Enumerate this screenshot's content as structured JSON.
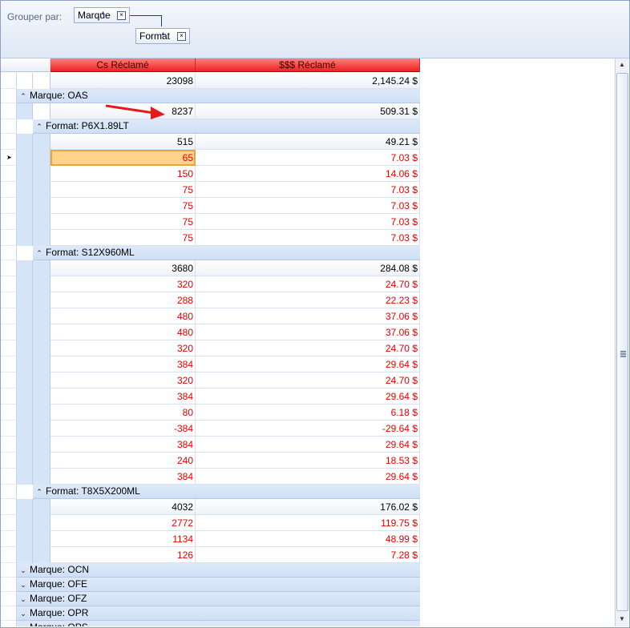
{
  "group_panel": {
    "label": "Grouper par:",
    "chips": [
      {
        "label": "Marque",
        "close": "×"
      },
      {
        "label": "Format",
        "close": "×"
      }
    ]
  },
  "columns": [
    "Cs Réclamé",
    "$$$ Réclamé"
  ],
  "grand_total": {
    "cs": "23098",
    "amount": "2,145.24 $"
  },
  "groups": [
    {
      "label": "Marque: OAS",
      "total": {
        "cs": "8237",
        "amount": "509.31 $"
      },
      "subgroups": [
        {
          "label": "Format: P6X1.89LT",
          "total": {
            "cs": "515",
            "amount": "49.21 $"
          },
          "rows": [
            {
              "cs": "65",
              "amount": "7.03 $"
            },
            {
              "cs": "150",
              "amount": "14.06 $"
            },
            {
              "cs": "75",
              "amount": "7.03 $"
            },
            {
              "cs": "75",
              "amount": "7.03 $"
            },
            {
              "cs": "75",
              "amount": "7.03 $"
            },
            {
              "cs": "75",
              "amount": "7.03 $"
            }
          ]
        },
        {
          "label": "Format: S12X960ML",
          "total": {
            "cs": "3680",
            "amount": "284.08 $"
          },
          "rows": [
            {
              "cs": "320",
              "amount": "24.70 $"
            },
            {
              "cs": "288",
              "amount": "22.23 $"
            },
            {
              "cs": "480",
              "amount": "37.06 $"
            },
            {
              "cs": "480",
              "amount": "37.06 $"
            },
            {
              "cs": "320",
              "amount": "24.70 $"
            },
            {
              "cs": "384",
              "amount": "29.64 $"
            },
            {
              "cs": "320",
              "amount": "24.70 $"
            },
            {
              "cs": "384",
              "amount": "29.64 $"
            },
            {
              "cs": "80",
              "amount": "6.18 $"
            },
            {
              "cs": "-384",
              "amount": "-29.64 $"
            },
            {
              "cs": "384",
              "amount": "29.64 $"
            },
            {
              "cs": "240",
              "amount": "18.53 $"
            },
            {
              "cs": "384",
              "amount": "29.64 $"
            }
          ]
        },
        {
          "label": "Format: T8X5X200ML",
          "total": {
            "cs": "4032",
            "amount": "176.02 $"
          },
          "rows": [
            {
              "cs": "2772",
              "amount": "119.75 $"
            },
            {
              "cs": "1134",
              "amount": "48.99 $"
            },
            {
              "cs": "126",
              "amount": "7.28 $"
            }
          ]
        }
      ]
    }
  ],
  "collapsed_groups": [
    "Marque: OCN",
    "Marque: OFE",
    "Marque: OFZ",
    "Marque: OPR",
    "Marque: OPS"
  ],
  "icons": {
    "expanded": "chevron-up-icon",
    "collapsed": "chevron-down-icon",
    "row_indicator": "triangle-right-icon"
  }
}
